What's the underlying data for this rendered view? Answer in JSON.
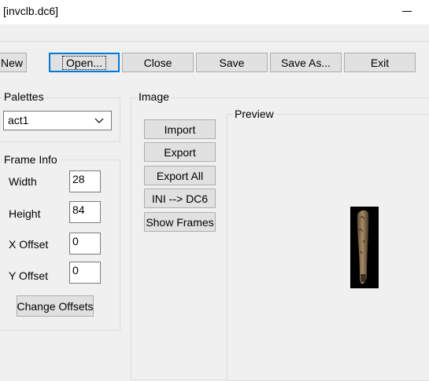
{
  "window": {
    "title": "[invclb.dc6]",
    "minimize_glyph": "–"
  },
  "toolbar": {
    "new_label": "New",
    "open_label": "Open...",
    "close_label": "Close",
    "save_label": "Save",
    "save_as_label": "Save As...",
    "exit_label": "Exit"
  },
  "palettes": {
    "group_label": "Palettes",
    "selected": "act1"
  },
  "frame_info": {
    "group_label": "Frame Info",
    "width_label": "Width",
    "width_value": "28",
    "height_label": "Height",
    "height_value": "84",
    "x_offset_label": "X Offset",
    "x_offset_value": "0",
    "y_offset_label": "Y Offset",
    "y_offset_value": "0",
    "change_offsets_label": "Change Offsets"
  },
  "image": {
    "group_label": "Image",
    "import_label": "Import",
    "export_label": "Export",
    "export_all_label": "Export All",
    "ini_to_dc6_label": "INI --> DC6",
    "show_frames_label": "Show Frames"
  },
  "preview": {
    "group_label": "Preview",
    "sprite_name": "club-sprite"
  },
  "colors": {
    "focus": "#0078d7",
    "sprite_background": "#000000"
  }
}
